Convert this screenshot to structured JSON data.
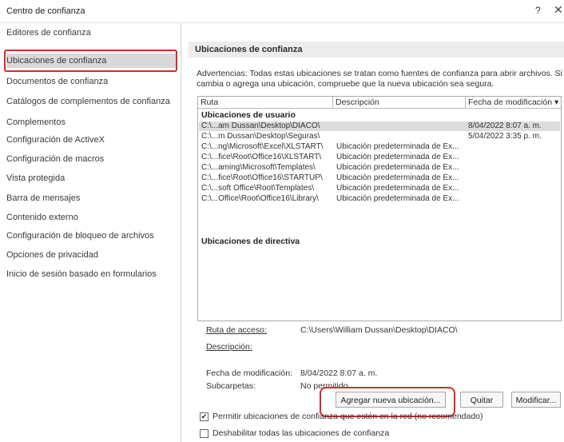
{
  "window": {
    "title": "Centro de confianza",
    "help_label": "?",
    "close_label": "✕"
  },
  "sidebar": {
    "items": [
      {
        "label": "Editores de confianza"
      },
      {
        "label": "Ubicaciones de confianza"
      },
      {
        "label": "Documentos de confianza"
      },
      {
        "label": "Catálogos de complementos de confianza"
      },
      {
        "label": "Complementos"
      },
      {
        "label": "Configuración de ActiveX"
      },
      {
        "label": "Configuración de macros"
      },
      {
        "label": "Vista protegida"
      },
      {
        "label": "Barra de mensajes"
      },
      {
        "label": "Contenido externo"
      },
      {
        "label": "Configuración de bloqueo de archivos"
      },
      {
        "label": "Opciones de privacidad"
      },
      {
        "label": "Inicio de sesión basado en formularios"
      }
    ],
    "selected_index": 1
  },
  "main": {
    "section_title": "Ubicaciones de confianza",
    "warning_line1": "Advertencias: Todas estas ubicaciones se tratan como fuentes de confianza para abrir archivos. Si",
    "warning_line2": "cambia o agrega una ubicación, compruebe que la nueva ubicación sea segura.",
    "table": {
      "columns": [
        "Ruta",
        "Descripción",
        "Fecha de modificación ▾"
      ],
      "user_group_label": "Ubicaciones de usuario",
      "user_rows": [
        {
          "path": "C:\\...am Dussan\\Desktop\\DIACO\\",
          "desc": "",
          "date": "8/04/2022 8:07 a. m."
        },
        {
          "path": "C:\\...m Dussan\\Desktop\\Seguras\\",
          "desc": "",
          "date": "5/04/2022 3:35 p. m."
        },
        {
          "path": "C:\\...ng\\Microsoft\\Excel\\XLSTART\\",
          "desc": "Ubicación predeterminada de Ex...",
          "date": ""
        },
        {
          "path": "C:\\...fice\\Root\\Office16\\XLSTART\\",
          "desc": "Ubicación predeterminada de Ex...",
          "date": ""
        },
        {
          "path": "C:\\...aming\\Microsoft\\Templates\\",
          "desc": "Ubicación predeterminada de Ex...",
          "date": ""
        },
        {
          "path": "C:\\...fice\\Root\\Office16\\STARTUP\\",
          "desc": "Ubicación predeterminada de Ex...",
          "date": ""
        },
        {
          "path": "C:\\...soft Office\\Root\\Templates\\",
          "desc": "Ubicación predeterminada de Ex...",
          "date": ""
        },
        {
          "path": "C:\\...Office\\Root\\Office16\\Library\\",
          "desc": "Ubicación predeterminada de Ex...",
          "date": ""
        }
      ],
      "policy_group_label": "Ubicaciones de directiva"
    },
    "details": {
      "path_label": "Ruta de acceso:",
      "path_value": "C:\\Users\\William Dussan\\Desktop\\DIACO\\",
      "description_label": "Descripción:",
      "modified_label": "Fecha de modificación:",
      "modified_value": "8/04/2022 8:07 a. m.",
      "subfolders_label": "Subcarpetas:",
      "subfolders_value": "No permitido"
    },
    "buttons": {
      "add": "Agregar nueva ubicación...",
      "remove": "Quitar",
      "modify": "Modificar..."
    },
    "checkboxes": {
      "allow_network": {
        "label": "Permitir ubicaciones de confianza que estén en la red (no recomendado)",
        "checked": true
      },
      "disable_all": {
        "label": "Deshabilitar todas las ubicaciones de confianza",
        "checked": false
      }
    }
  }
}
